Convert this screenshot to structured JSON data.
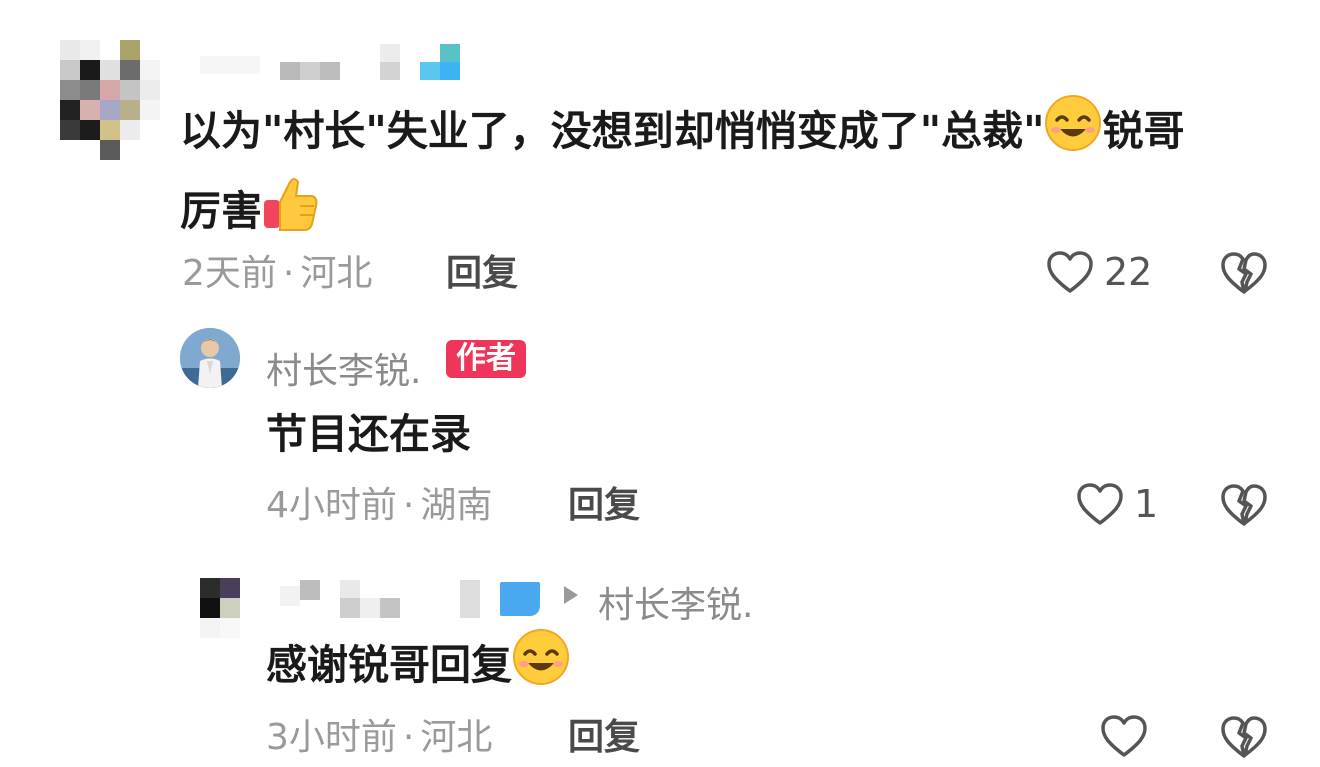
{
  "comment1": {
    "text_line1": "以为\"村长\"失业了，没想到却悄悄变成了\"总裁\"",
    "text_line1_tail": "锐哥",
    "text_line2": "厉害",
    "emoji1": "smiling-face-emoji",
    "emoji2": "thumbs-up-emoji",
    "time": "2天前",
    "location": "河北",
    "reply_label": "回复",
    "like_count": "22"
  },
  "reply1": {
    "author": "村长李锐.",
    "badge": "作者",
    "text": "节目还在录",
    "time": "4小时前",
    "location": "湖南",
    "reply_label": "回复",
    "like_count": "1"
  },
  "reply2": {
    "reply_to": "村长李锐.",
    "text": "感谢锐哥回复",
    "emoji": "smiling-face-emoji",
    "time": "3小时前",
    "location": "河北",
    "reply_label": "回复",
    "like_count": ""
  },
  "separator": "·",
  "colors": {
    "badge_bg": "#f0355a",
    "meta_text": "#9a9a9a",
    "main_text": "#1a1a1a"
  }
}
